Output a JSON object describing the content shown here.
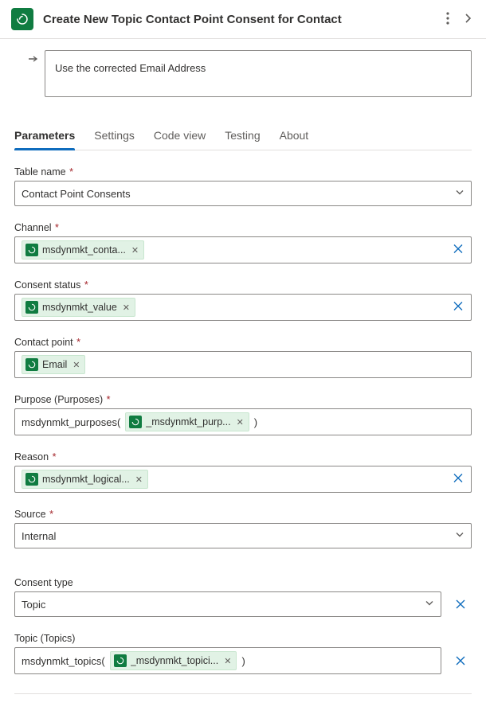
{
  "header": {
    "title": "Create New Topic Contact Point Consent for Contact"
  },
  "note": {
    "text": "Use the corrected Email Address"
  },
  "tabs": {
    "parameters": "Parameters",
    "settings": "Settings",
    "code_view": "Code view",
    "testing": "Testing",
    "about": "About"
  },
  "fields": {
    "table_name": {
      "label": "Table name",
      "value": "Contact Point Consents"
    },
    "channel": {
      "label": "Channel",
      "token": "msdynmkt_conta..."
    },
    "consent_status": {
      "label": "Consent status",
      "token": "msdynmkt_value"
    },
    "contact_point": {
      "label": "Contact point",
      "token": "Email"
    },
    "purpose": {
      "label": "Purpose (Purposes)",
      "expr_prefix": "msdynmkt_purposes(",
      "token": "_msdynmkt_purp...",
      "expr_suffix": ")"
    },
    "reason": {
      "label": "Reason",
      "token": "msdynmkt_logical..."
    },
    "source": {
      "label": "Source",
      "value": "Internal"
    },
    "consent_type": {
      "label": "Consent type",
      "value": "Topic"
    },
    "topic": {
      "label": "Topic (Topics)",
      "expr_prefix": "msdynmkt_topics(",
      "token": "_msdynmkt_topici...",
      "expr_suffix": ")"
    }
  }
}
